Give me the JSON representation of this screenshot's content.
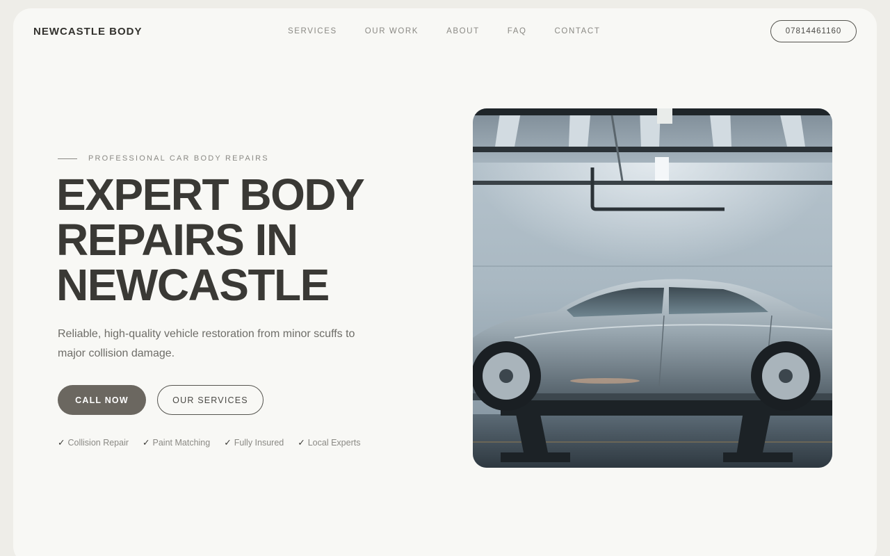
{
  "brand": "NEWCASTLE BODY",
  "nav": {
    "items": [
      "SERVICES",
      "OUR WORK",
      "ABOUT",
      "FAQ",
      "CONTACT"
    ],
    "phone": "07814461160"
  },
  "hero": {
    "eyebrow": "PROFESSIONAL CAR BODY REPAIRS",
    "headline": [
      "EXPERT BODY",
      "REPAIRS IN",
      "NEWCASTLE"
    ],
    "subtext": "Reliable, high-quality vehicle restoration from minor scuffs to major collision damage.",
    "primary_cta": "CALL NOW",
    "secondary_cta": "OUR SERVICES",
    "features": [
      "Collision Repair",
      "Paint Matching",
      "Fully Insured",
      "Local Experts"
    ],
    "check_glyph": "✓",
    "image": "car-on-lift-photo"
  },
  "colors": {
    "background": "#f8f8f5",
    "text_dark": "#3a3935",
    "text_muted": "#8a8984",
    "primary_button": "#6b6760"
  }
}
